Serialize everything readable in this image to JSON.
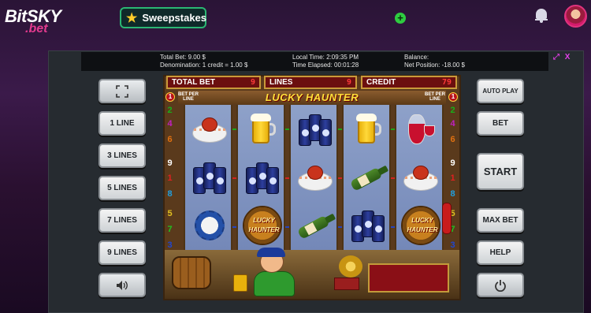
{
  "header": {
    "logo_line1": "BitSKY",
    "logo_line2": ".bet",
    "sweepstakes_label": "Sweepstakes",
    "add_funds_label": "+"
  },
  "info_bar": {
    "total_bet": "Total Bet: 9.00 $",
    "denomination": "Denomination: 1 credit = 1.00 $",
    "local_time": "Local Time: 2:09:35 PM",
    "time_elapsed": "Time Elapsed: 00:01:28",
    "balance": "Balance:",
    "net_position": "Net Position: -18.00 $",
    "close_label": "X"
  },
  "left_buttons": {
    "fullscreen_icon": "fullscreen-icon",
    "line1": "1 LINE",
    "line3": "3 LINES",
    "line5": "5 LINES",
    "line7": "7 LINES",
    "line9": "9 LINES",
    "sound_icon": "speaker-icon"
  },
  "right_buttons": {
    "auto_play": "AUTO PLAY",
    "bet": "BET",
    "start": "START",
    "max_bet": "MAX BET",
    "help": "HELP",
    "power_icon": "power-icon"
  },
  "hud": {
    "total_bet_label": "TOTAL BET",
    "total_bet_value": "9",
    "lines_label": "LINES",
    "lines_value": "9",
    "credit_label": "CREDIT",
    "credit_value": "79"
  },
  "machine": {
    "title": "LUCKY HAUNTER",
    "bet_per_line_left": "BET PER LINE",
    "bet_per_line_right": "BET PER LINE",
    "bet_per_line_left_value": "1",
    "bet_per_line_right_value": "1",
    "lucky_text_1": "LUCKY",
    "lucky_text_2": "HAUNTER",
    "lucky_text_3": "LUCKY",
    "lucky_text_4": "HAUNTER",
    "left_line_numbers": [
      "2",
      "4",
      "6",
      "9",
      "1",
      "8",
      "5",
      "7",
      "3"
    ],
    "right_line_numbers": [
      "2",
      "4",
      "6",
      "9",
      "1",
      "8",
      "5",
      "7",
      "3"
    ],
    "line_colors": {
      "1": "#e02020",
      "2": "#18b018",
      "3": "#2046d0",
      "4": "#c020c0",
      "5": "#e0c020",
      "6": "#e07010",
      "7": "#20c020",
      "8": "#20a0e0",
      "9": "#ffffff"
    },
    "reels": [
      [
        "crab",
        "cans",
        "cap"
      ],
      [
        "beer",
        "cans",
        "lucky"
      ],
      [
        "cans",
        "crab",
        "bottle"
      ],
      [
        "beer",
        "bottle",
        "cans"
      ],
      [
        "wine",
        "crab",
        "lucky"
      ]
    ]
  },
  "colors": {
    "accent_pink": "#e23a8e",
    "sweepstakes_border": "#2bb673",
    "frame_icon": "#d23cd6"
  }
}
